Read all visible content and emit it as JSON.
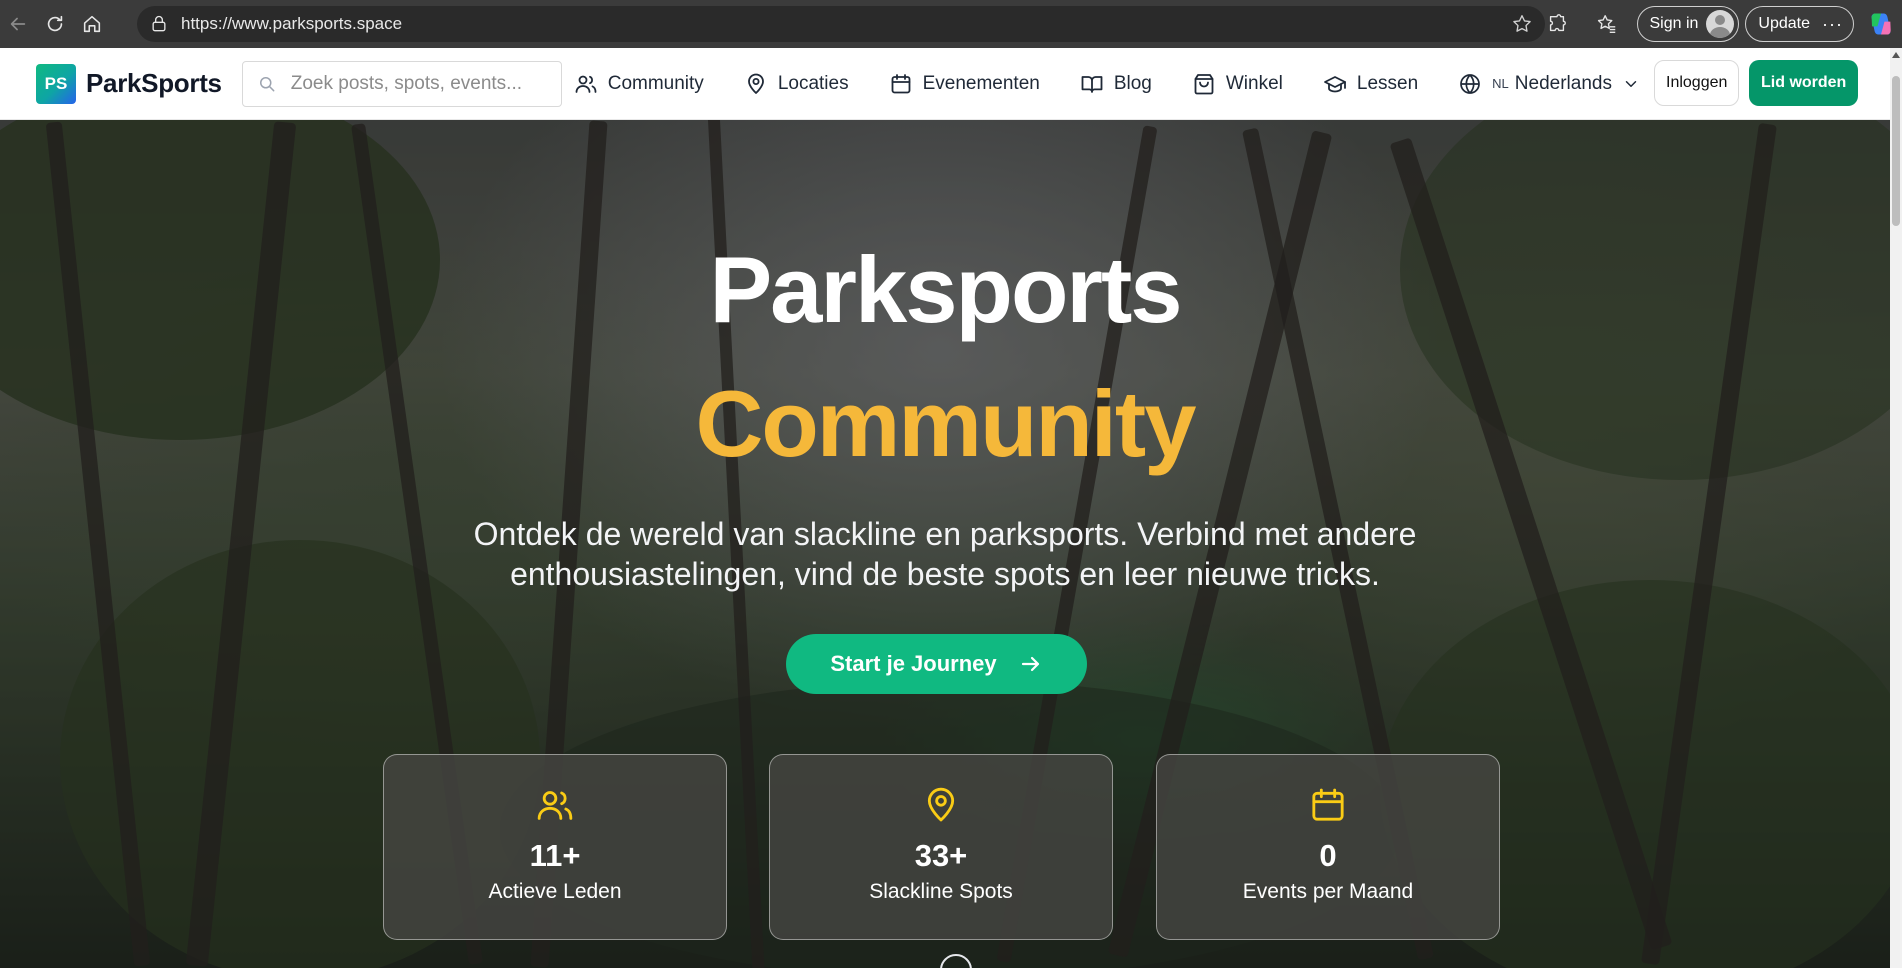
{
  "browser": {
    "url": "https://www.parksports.space",
    "sign_in_label": "Sign in",
    "update_label": "Update",
    "more_label": "···"
  },
  "header": {
    "logo_badge": "PS",
    "logo_text": "ParkSports",
    "search_placeholder": "Zoek posts, spots, events...",
    "nav": [
      {
        "label": "Community",
        "icon": "users-icon"
      },
      {
        "label": "Locaties",
        "icon": "map-pin-icon"
      },
      {
        "label": "Evenementen",
        "icon": "calendar-icon"
      },
      {
        "label": "Blog",
        "icon": "book-open-icon"
      },
      {
        "label": "Winkel",
        "icon": "shopping-bag-icon"
      },
      {
        "label": "Lessen",
        "icon": "graduation-cap-icon"
      }
    ],
    "language_code": "NL",
    "language_label": "Nederlands",
    "login_label": "Inloggen",
    "join_label": "Lid worden"
  },
  "hero": {
    "title_line1": "Parksports",
    "title_line2": "Community",
    "subtitle": "Ontdek de wereld van slackline en parksports. Verbind met andere enthousiastelingen, vind de beste spots en leer nieuwe tricks.",
    "cta_label": "Start je Journey",
    "stats": [
      {
        "value": "11+",
        "label": "Actieve Leden",
        "icon": "users-icon"
      },
      {
        "value": "33+",
        "label": "Slackline Spots",
        "icon": "map-pin-icon"
      },
      {
        "value": "0",
        "label": "Events per Maand",
        "icon": "calendar-icon"
      }
    ]
  },
  "colors": {
    "brand_green": "#059669",
    "cta_green": "#10b981",
    "accent_yellow": "#f5b83a",
    "header_bg": "#ffffff"
  }
}
